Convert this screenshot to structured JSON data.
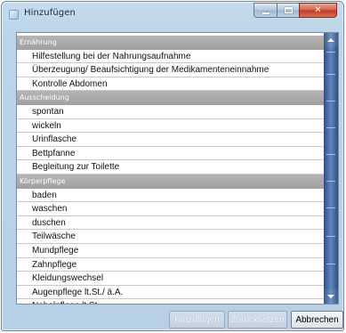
{
  "window": {
    "title": "Hinzufügen"
  },
  "groups": [
    {
      "header": "Ernährung",
      "items": [
        "Hilfestellung bei der Nahrungsaufnahme",
        "Überzeugung/ Beaufsichtigung der Medikamenteneinnahme",
        "Kontrolle Abdomen"
      ]
    },
    {
      "header": "Ausscheidung",
      "items": [
        "spontan",
        "wickeln",
        "Urinflasche",
        "Bettpfanne",
        "Begleitung zur Toilette"
      ]
    },
    {
      "header": "Körperpflege",
      "items": [
        "baden",
        "waschen",
        "duschen",
        "Teilwäsche",
        "Mundpflege",
        "Zahnpflege",
        "Kleidungswechsel",
        "Augenpflege lt.St./ ä.A.",
        "Nabelpflege lt.St."
      ]
    }
  ],
  "buttons": {
    "add": "Hinzufügen",
    "reset": "Zurücksetzen",
    "cancel": "Abbrechen"
  }
}
